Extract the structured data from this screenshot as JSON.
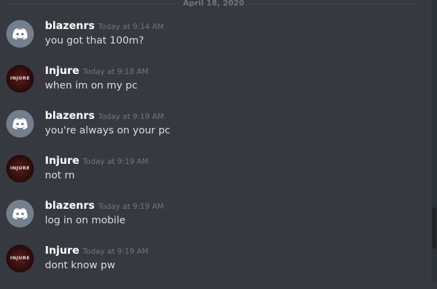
{
  "divider": {
    "date": "April 18, 2020"
  },
  "messages": [
    {
      "author": "blazenrs",
      "avatar": "discord-logo-icon",
      "timestamp": "Today at 9:14 AM",
      "text": "you got that 100m?"
    },
    {
      "author": "Injure",
      "avatar": "injure-logo-avatar",
      "avatar_text": "INJURE",
      "timestamp": "Today at 9:18 AM",
      "text": "when im on my pc"
    },
    {
      "author": "blazenrs",
      "avatar": "discord-logo-icon",
      "timestamp": "Today at 9:19 AM",
      "text": "you're always on your pc"
    },
    {
      "author": "Injure",
      "avatar": "injure-logo-avatar",
      "avatar_text": "INJURE",
      "timestamp": "Today at 9:19 AM",
      "text": "not rn"
    },
    {
      "author": "blazenrs",
      "avatar": "discord-logo-icon",
      "timestamp": "Today at 9:19 AM",
      "text": "log in on mobile"
    },
    {
      "author": "Injure",
      "avatar": "injure-logo-avatar",
      "avatar_text": "INJURE",
      "timestamp": "Today at 9:19 AM",
      "text": "dont know pw"
    }
  ],
  "colors": {
    "background": "#36393f",
    "username": "#ffffff",
    "timestamp": "#72767d",
    "message_text": "#dcddde",
    "discord_avatar": "#747f8d"
  }
}
